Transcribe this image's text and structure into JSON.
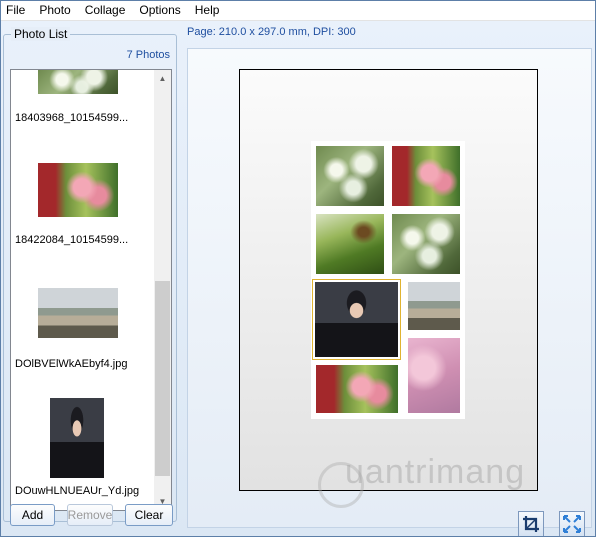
{
  "menu": [
    "File",
    "Photo",
    "Collage",
    "Options",
    "Help"
  ],
  "photo_list": {
    "title": "Photo List",
    "count": "7 Photos",
    "items": [
      {
        "name": "18403968_10154599..."
      },
      {
        "name": "18422084_10154599..."
      },
      {
        "name": "DOlBVElWkAEbyf4.jpg"
      },
      {
        "name": "DOuwHLNUEAUr_Yd.jpg"
      }
    ]
  },
  "buttons": {
    "add": "Add",
    "remove": "Remove",
    "clear": "Clear"
  },
  "page_info": "Page: 210.0 x 297.0 mm, DPI: 300",
  "watermark": "uantrimang"
}
